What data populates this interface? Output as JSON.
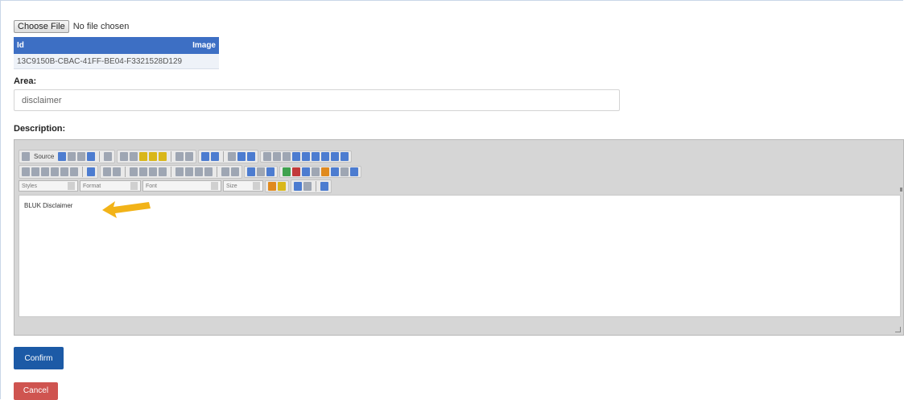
{
  "file_input": {
    "button_label": "Choose File",
    "status": "No file chosen"
  },
  "image_table": {
    "headers": [
      "Id",
      "Image"
    ],
    "rows": [
      {
        "id": "13C9150B-CBAC-41FF-BE04-F3321528D129",
        "image": ""
      }
    ]
  },
  "area": {
    "label": "Area:",
    "value": "disclaimer"
  },
  "description": {
    "label": "Description:",
    "toolbar": {
      "source_label": "Source",
      "styles_placeholder": "Styles",
      "format_placeholder": "Format",
      "font_placeholder": "Font",
      "size_placeholder": "Size"
    },
    "content": "BLUK Disclaimer"
  },
  "buttons": {
    "confirm": "Confirm",
    "cancel": "Cancel"
  },
  "colors": {
    "primary": "#1c5aa6",
    "danger": "#cf5450",
    "table_header": "#3d6fc4",
    "arrow": "#f2b318"
  }
}
